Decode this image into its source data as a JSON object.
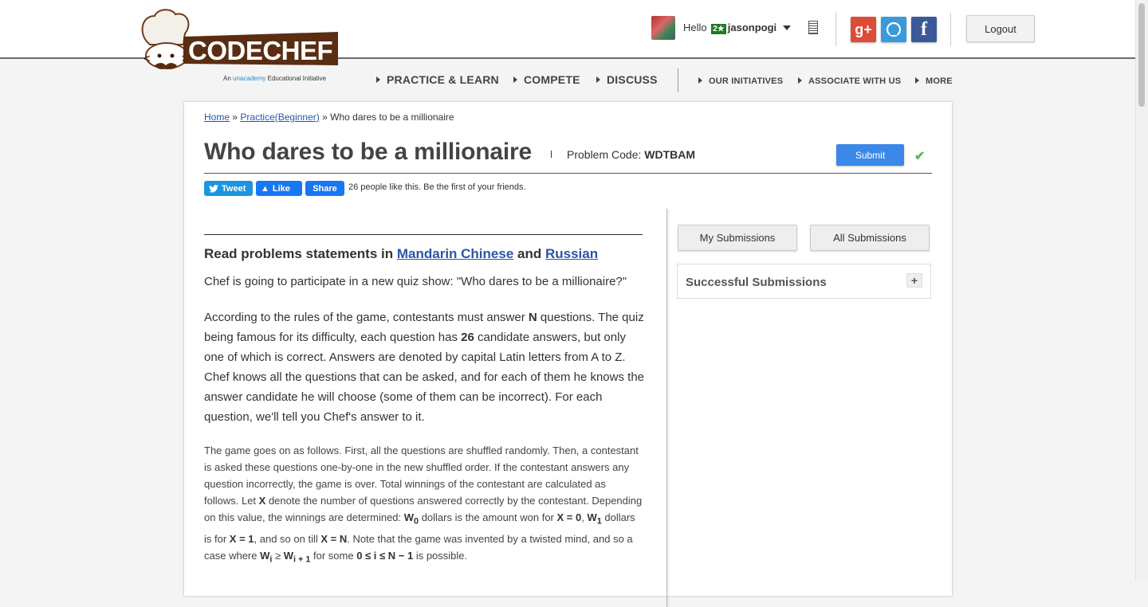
{
  "logo": {
    "text": "CODECHEF",
    "tagline_prefix": "An",
    "tagline_brand": "unacademy",
    "tagline_suffix": "Educational Initiative"
  },
  "header": {
    "greeting": "Hello",
    "user_rank": "2★",
    "username": "jasonpogi",
    "logout_label": "Logout"
  },
  "social": {
    "google_label": "g+",
    "github_label": "",
    "facebook_label": "f"
  },
  "nav": {
    "primary": [
      "PRACTICE & LEARN",
      "COMPETE",
      "DISCUSS"
    ],
    "secondary": [
      "OUR INITIATIVES",
      "ASSOCIATE WITH US",
      "MORE"
    ]
  },
  "breadcrumb": {
    "home": "Home",
    "sep": "»",
    "practice": "Practice(Beginner)",
    "current": "Who dares to be a millionaire"
  },
  "problem": {
    "title": "Who dares to be a millionaire",
    "code_label": "Problem Code:",
    "code": "WDTBAM",
    "submit_label": "Submit"
  },
  "share": {
    "tweet": "Tweet",
    "like": "Like",
    "share": "Share",
    "likes_text": "26 people like this. Be the first of your friends."
  },
  "statement": {
    "read_prefix": "Read problems statements in",
    "lang1": "Mandarin Chinese",
    "and": "and",
    "lang2": "Russian",
    "p1": "Chef is going to participate in a new quiz show: \"Who dares to be a millionaire?\""
  },
  "sidebar": {
    "my_submissions": "My Submissions",
    "all_submissions": "All Submissions",
    "successful_submissions": "Successful Submissions",
    "expand": "+"
  },
  "colors": {
    "link": "#2b56a6",
    "submit": "#3b88e8",
    "google": "#dd4b39",
    "github": "#3a9ad9",
    "facebook": "#3b5998",
    "tweet": "#1b95e0",
    "fb_like": "#1877f2",
    "check": "#5cb85c"
  }
}
